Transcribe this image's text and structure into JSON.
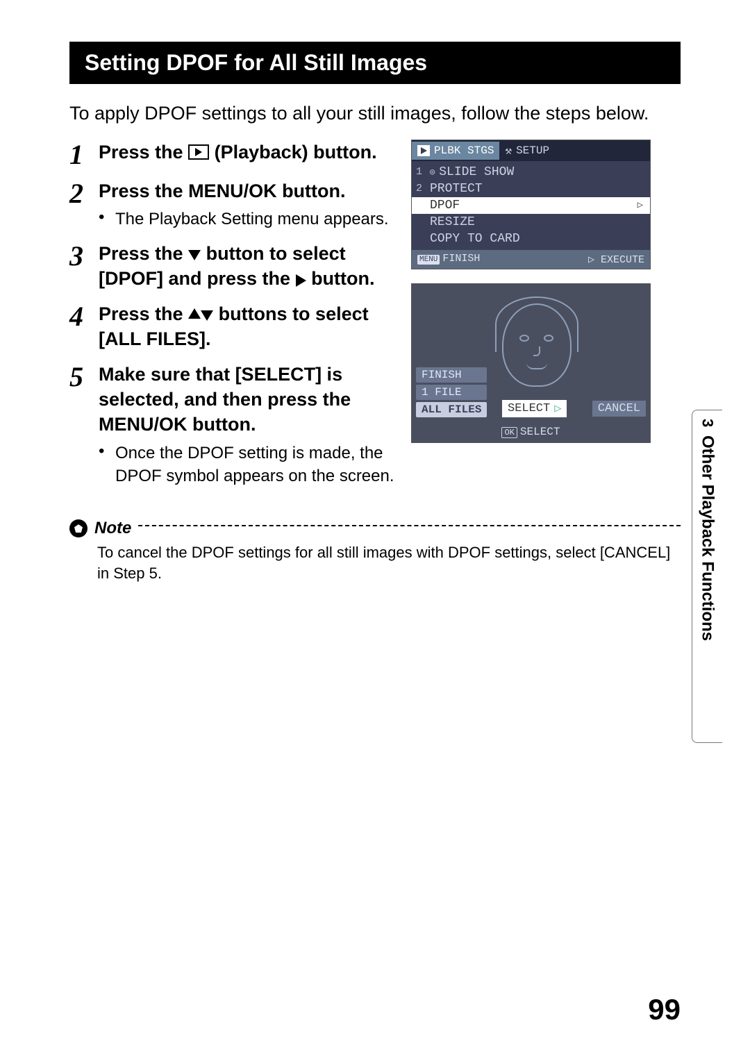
{
  "header": {
    "title": "Setting DPOF for All Still Images"
  },
  "intro": "To apply DPOF settings to all your still images, follow the steps below.",
  "steps": [
    {
      "num": "1",
      "title_parts": [
        "Press the ",
        " (Playback) button."
      ],
      "icon": "playback-rect"
    },
    {
      "num": "2",
      "title": "Press the MENU/OK button.",
      "sub": "The Playback Setting menu appears."
    },
    {
      "num": "3",
      "title_parts": [
        "Press the ",
        " button to select [DPOF] and press the ",
        " button."
      ],
      "icons": [
        "tri-down",
        "tri-right"
      ]
    },
    {
      "num": "4",
      "title_parts": [
        "Press the ",
        " buttons to select [ALL FILES]."
      ],
      "icons": [
        "tri-up-down"
      ]
    },
    {
      "num": "5",
      "title": "Make sure that [SELECT] is selected, and then press the MENU/OK button.",
      "sub": "Once the DPOF setting is made, the DPOF symbol appears on the screen."
    }
  ],
  "camera_menu": {
    "tab_active": "PLBK STGS",
    "tab_inactive": "SETUP",
    "items": [
      {
        "idx": "1",
        "label": "SLIDE SHOW"
      },
      {
        "idx": "2",
        "label": "PROTECT"
      },
      {
        "idx": "",
        "label": "DPOF",
        "selected": true
      },
      {
        "idx": "",
        "label": "RESIZE"
      },
      {
        "idx": "",
        "label": "COPY TO CARD"
      }
    ],
    "footer_left_badge": "MENU",
    "footer_left": "FINISH",
    "footer_right_icon": "▷",
    "footer_right": "EXECUTE"
  },
  "camera_preview": {
    "options": [
      "FINISH",
      "1 FILE",
      "ALL FILES"
    ],
    "highlight_index": 2,
    "select_label": "SELECT",
    "cancel_label": "CANCEL",
    "footer_badge": "OK",
    "footer_label": "SELECT"
  },
  "note": {
    "label": "Note",
    "body": "To cancel the DPOF settings for all still images with DPOF settings, select [CANCEL] in Step 5."
  },
  "thumb_tab": {
    "chapter_num": "3",
    "chapter_title": "Other Playback Functions"
  },
  "page_number": "99"
}
